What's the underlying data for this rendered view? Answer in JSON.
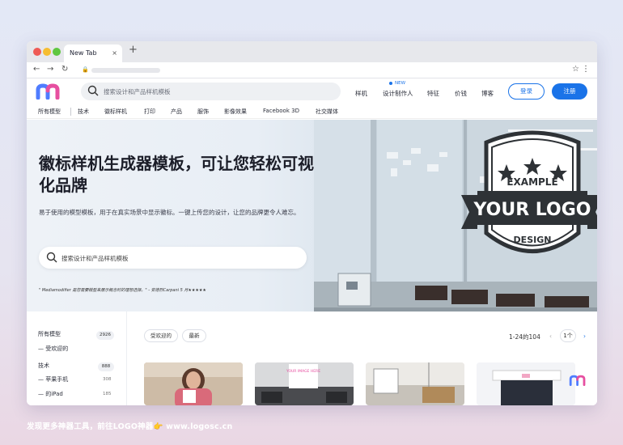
{
  "browser": {
    "tab_title": "New Tab",
    "tab_close": "×",
    "new_tab": "+"
  },
  "header": {
    "search_placeholder": "搜索设计和产品样机模板",
    "nav": [
      "样机",
      "设计制作人",
      "特征",
      "价钱",
      "博客"
    ],
    "new_badge": "NEW",
    "login": "登录",
    "register": "注册"
  },
  "categories": [
    "所有模型",
    "技术",
    "徽标样机",
    "打印",
    "产品",
    "服饰",
    "影像效果",
    "Facebook 3D",
    "社交媒体"
  ],
  "hero": {
    "title": "徽标样机生成器模板，可让您轻松可视化品牌",
    "description": "易于使用的模型模板，用于在真实场景中显示徽标。一键上传您的设计，让您的品牌更令人难忘。",
    "search_placeholder": "搜索设计和产品样机模板",
    "quote": "\" Mediamodifier 是您需要模型来展示概念时的理想选择。\" - 安德烈Carpani 5 月★★★★★",
    "sign_top": "EXAMPLE",
    "sign_main": "YOUR LOGO",
    "sign_bottom": "DESIGN"
  },
  "sidebar": {
    "all": {
      "label": "所有模型",
      "count": "2926"
    },
    "popular": "— 受欢迎的",
    "tech": {
      "label": "技术",
      "count": "888"
    },
    "iphone": {
      "label": "— 苹果手机",
      "count": "308"
    },
    "ipad": {
      "label": "— 的iPad",
      "count": "185"
    }
  },
  "filters": {
    "popular": "受欢迎的",
    "newest": "最新",
    "range": "1-24的104",
    "page": "1个"
  },
  "cards": {
    "sign_text": "YOUR IMAGE HERE"
  },
  "footer": {
    "text": "发现更多神器工具，前往LOGO神器👉 www.logosc.cn"
  },
  "colors": {
    "accent": "#1a73e8",
    "logo_blue": "#4f7cff",
    "logo_pink": "#e64fa0"
  }
}
